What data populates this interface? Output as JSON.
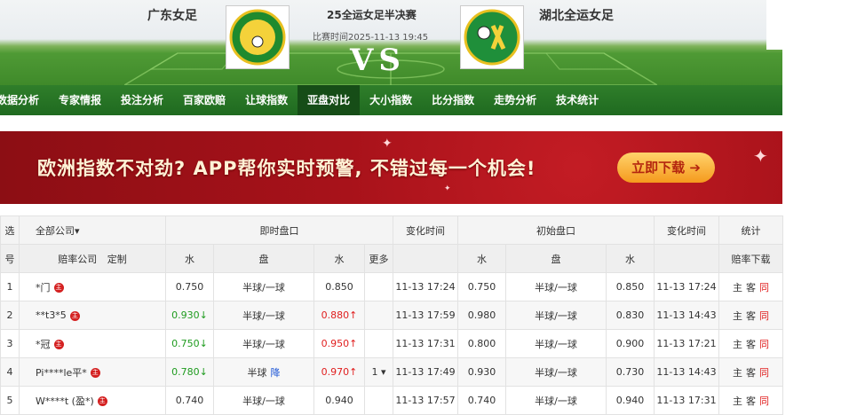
{
  "header": {
    "home_team": "广东女足",
    "away_team": "湖北全运女足",
    "match_title": "25全运女足半决赛",
    "match_time": "比赛时间2025-11-13 19:45",
    "vs": "VS"
  },
  "nav": [
    "数据分析",
    "专家情报",
    "投注分析",
    "百家欧赔",
    "让球指数",
    "亚盘对比",
    "大小指数",
    "比分指数",
    "走势分析",
    "技术统计"
  ],
  "nav_active": "亚盘对比",
  "banner": {
    "text": "欧洲指数不对劲? APP帮你实时预警, 不错过每一个机会!",
    "button": "立即下载 ➔"
  },
  "table": {
    "header1": {
      "select": "选",
      "company": "全部公司▾",
      "live": "即时盘口",
      "change_time": "变化时间",
      "initial": "初始盘口",
      "change_time2": "变化时间",
      "stats": "统计"
    },
    "header2": {
      "num": "号",
      "company": "赔率公司",
      "custom": "定制",
      "water1": "水",
      "handicap": "盘",
      "water2": "水",
      "more": "更多",
      "water3": "水",
      "handicap2": "盘",
      "water4": "水",
      "download": "赔率下载"
    },
    "rows": [
      {
        "n": "1",
        "company": "*门",
        "w1": "0.750",
        "w1_dir": "",
        "h": "半球/一球",
        "h_note": "",
        "w2": "0.850",
        "w2_dir": "",
        "more": "",
        "t1": "11-13 17:24",
        "iw1": "0.750",
        "ih": "半球/一球",
        "iw2": "0.850",
        "t2": "11-13 17:24"
      },
      {
        "n": "2",
        "company": "**t3*5",
        "w1": "0.930↓",
        "w1_dir": "down",
        "h": "半球/一球",
        "h_note": "",
        "w2": "0.880↑",
        "w2_dir": "up",
        "more": "",
        "t1": "11-13 17:59",
        "iw1": "0.980",
        "ih": "半球/一球",
        "iw2": "0.830",
        "t2": "11-13 14:43"
      },
      {
        "n": "3",
        "company": "*冠",
        "w1": "0.750↓",
        "w1_dir": "down",
        "h": "半球/一球",
        "h_note": "",
        "w2": "0.950↑",
        "w2_dir": "up",
        "more": "",
        "t1": "11-13 17:31",
        "iw1": "0.800",
        "ih": "半球/一球",
        "iw2": "0.900",
        "t2": "11-13 17:21"
      },
      {
        "n": "4",
        "company": "Pi****le平*",
        "w1": "0.780↓",
        "w1_dir": "down",
        "h": "半球",
        "h_note": "降",
        "w2": "0.970↑",
        "w2_dir": "up",
        "more": "1 ▾",
        "t1": "11-13 17:49",
        "iw1": "0.930",
        "ih": "半球/一球",
        "iw2": "0.730",
        "t2": "11-13 14:43"
      },
      {
        "n": "5",
        "company": "W****t (盈*)",
        "w1": "0.740",
        "w1_dir": "",
        "h": "半球/一球",
        "h_note": "",
        "w2": "0.940",
        "w2_dir": "",
        "more": "",
        "t1": "11-13 17:57",
        "iw1": "0.740",
        "ih": "半球/一球",
        "iw2": "0.940",
        "t2": "11-13 17:31"
      }
    ],
    "zhu_badge": "主",
    "stat_home": "主",
    "stat_away": "客",
    "stat_same": "同"
  }
}
